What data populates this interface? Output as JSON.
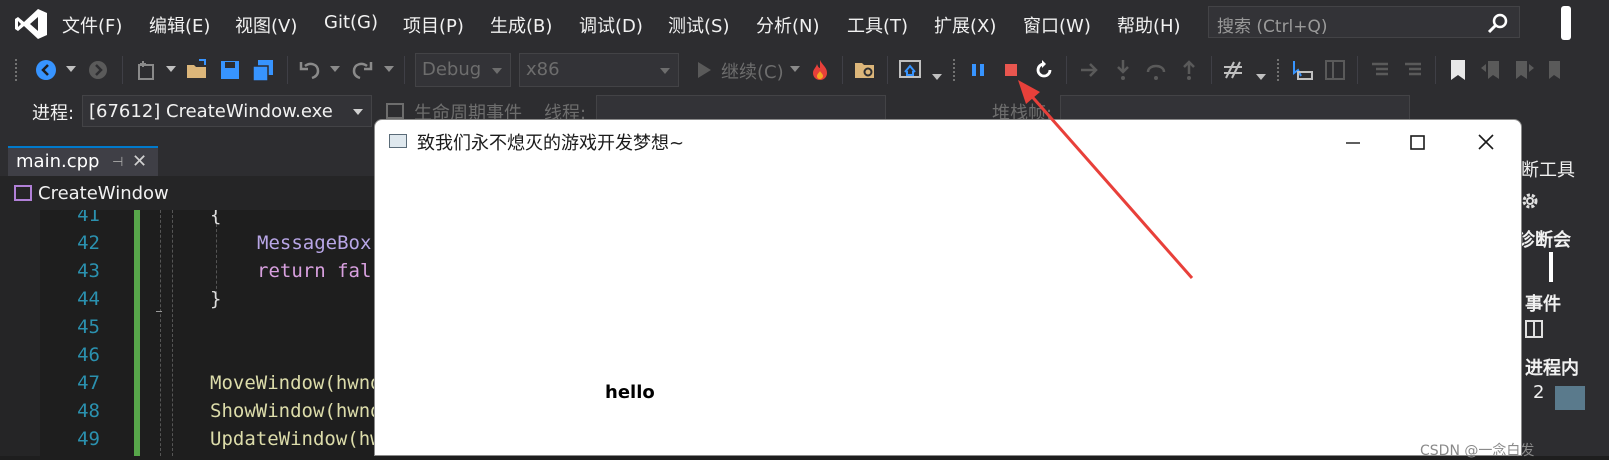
{
  "menu": {
    "items": [
      "文件(F)",
      "编辑(E)",
      "视图(V)",
      "Git(G)",
      "项目(P)",
      "生成(B)",
      "调试(D)",
      "测试(S)",
      "分析(N)",
      "工具(T)",
      "扩展(X)",
      "窗口(W)",
      "帮助(H)"
    ],
    "search_placeholder": "搜索 (Ctrl+Q)"
  },
  "toolbar": {
    "config": "Debug",
    "platform": "x86",
    "continue_label": "继续(C)"
  },
  "process_bar": {
    "label": "进程:",
    "process": "[67612] CreateWindow.exe",
    "lifecycle": "生命周期事件",
    "thread": "线程:",
    "stack": "堆栈帧:"
  },
  "editor": {
    "tab": "main.cpp",
    "nav": "CreateWindow",
    "lines": [
      {
        "n": "41",
        "code": "{"
      },
      {
        "n": "42",
        "code": "MessageBox"
      },
      {
        "n": "43",
        "code": "return fal"
      },
      {
        "n": "44",
        "code": "}"
      },
      {
        "n": "45",
        "code": ""
      },
      {
        "n": "46",
        "code": ""
      },
      {
        "n": "47",
        "code": "MoveWindow(hwnd"
      },
      {
        "n": "48",
        "code": "ShowWindow(hwnd"
      },
      {
        "n": "49",
        "code": "UpdateWindow(hw"
      }
    ]
  },
  "right_panel": {
    "texts": [
      "断工具",
      "诊断会",
      "事件",
      "进程内",
      "2"
    ]
  },
  "app_window": {
    "title": "致我们永不熄灭的游戏开发梦想~",
    "body_text": "hello"
  },
  "watermark": "CSDN @一念白发",
  "colors": {
    "accent": "#007acc",
    "stop": "#e8564f",
    "pause": "#3794ff",
    "annotation_arrow": "#e8403a"
  }
}
